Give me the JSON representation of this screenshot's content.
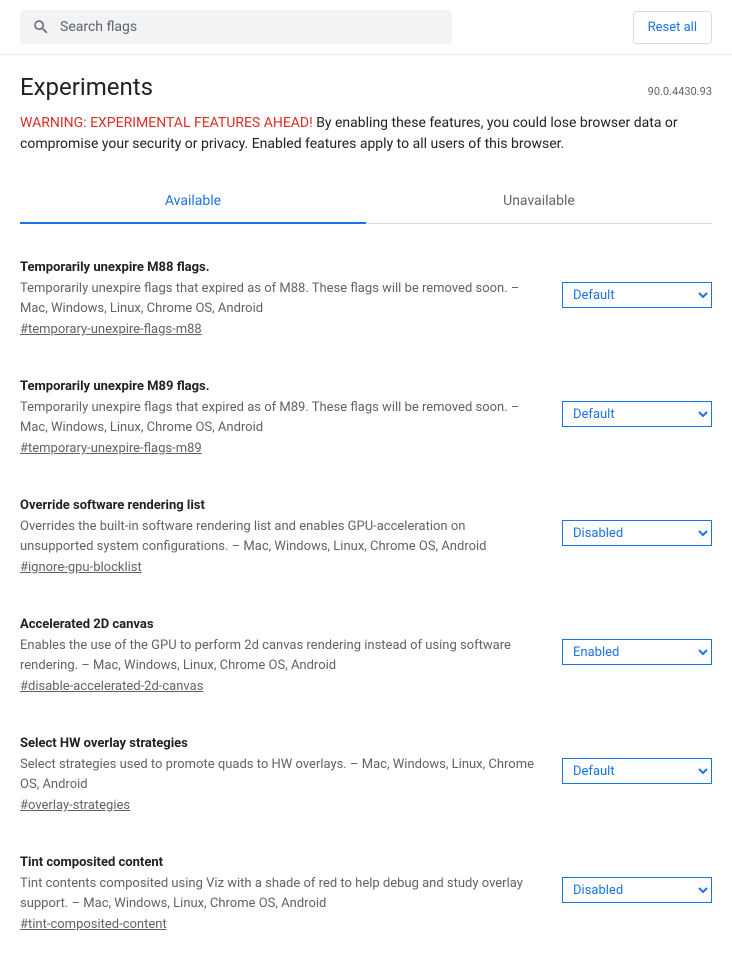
{
  "search": {
    "placeholder": "Search flags"
  },
  "reset_label": "Reset all",
  "title": "Experiments",
  "version": "90.0.4430.93",
  "warning_label": "WARNING: EXPERIMENTAL FEATURES AHEAD!",
  "warning_body": " By enabling these features, you could lose browser data or compromise your security or privacy. Enabled features apply to all users of this browser.",
  "tabs": {
    "available": "Available",
    "unavailable": "Unavailable"
  },
  "select_options": [
    "Default",
    "Enabled",
    "Disabled"
  ],
  "flags": [
    {
      "title": "Temporarily unexpire M88 flags.",
      "desc": "Temporarily unexpire flags that expired as of M88. These flags will be removed soon. – Mac, Windows, Linux, Chrome OS, Android",
      "tag": "#temporary-unexpire-flags-m88",
      "value": "Default"
    },
    {
      "title": "Temporarily unexpire M89 flags.",
      "desc": "Temporarily unexpire flags that expired as of M89. These flags will be removed soon. – Mac, Windows, Linux, Chrome OS, Android",
      "tag": "#temporary-unexpire-flags-m89",
      "value": "Default"
    },
    {
      "title": "Override software rendering list",
      "desc": "Overrides the built-in software rendering list and enables GPU-acceleration on unsupported system configurations. – Mac, Windows, Linux, Chrome OS, Android",
      "tag": "#ignore-gpu-blocklist",
      "value": "Disabled"
    },
    {
      "title": "Accelerated 2D canvas",
      "desc": "Enables the use of the GPU to perform 2d canvas rendering instead of using software rendering. – Mac, Windows, Linux, Chrome OS, Android",
      "tag": "#disable-accelerated-2d-canvas",
      "value": "Enabled"
    },
    {
      "title": "Select HW overlay strategies",
      "desc": "Select strategies used to promote quads to HW overlays. – Mac, Windows, Linux, Chrome OS, Android",
      "tag": "#overlay-strategies",
      "value": "Default"
    },
    {
      "title": "Tint composited content",
      "desc": "Tint contents composited using Viz with a shade of red to help debug and study overlay support. – Mac, Windows, Linux, Chrome OS, Android",
      "tag": "#tint-composited-content",
      "value": "Disabled"
    }
  ]
}
